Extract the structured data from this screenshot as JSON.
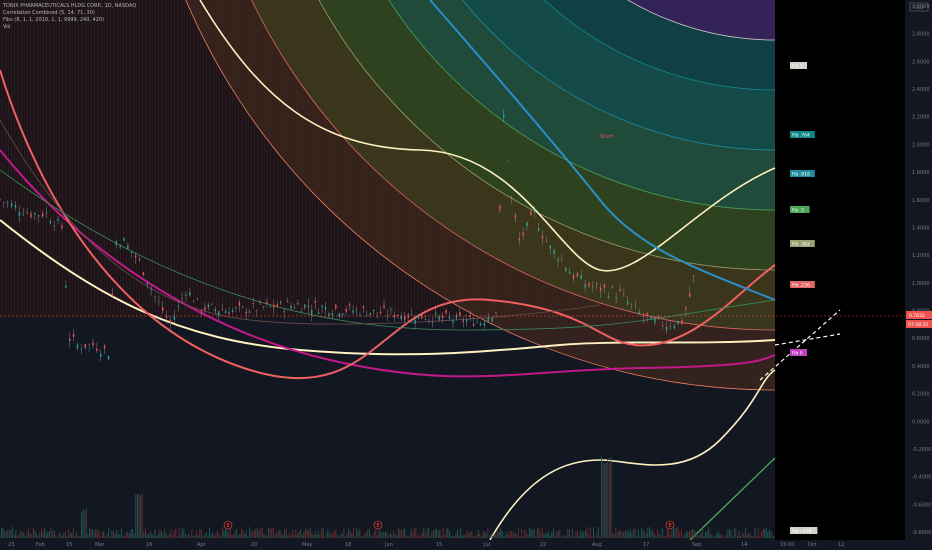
{
  "legend": {
    "symbol": "TONIX PHARMACEUTICALS HLDG CORP., 1D, NASDAQ",
    "indicator1": "Correlation Combined (5, 14, 71, 30)",
    "indicator2": "Fibs (8, 1, 1, 2010, 1, 1, 9999, 240, 420)",
    "indicator3": "Vol"
  },
  "chart_data": {
    "type": "line",
    "currency": "USD",
    "x_axis_ticks": [
      "23",
      "Feb",
      "15",
      "Mar",
      "16",
      "Apr",
      "20",
      "May",
      "18",
      "Jun",
      "15",
      "Jul",
      "22",
      "Aug",
      "17",
      "Sep",
      "14",
      "15:00",
      "Oct",
      "12"
    ],
    "y_axis_ticks": [
      "3.0000",
      "2.8000",
      "2.6000",
      "2.4000",
      "2.2000",
      "2.0000",
      "1.8000",
      "1.6000",
      "1.4000",
      "1.2000",
      "1.0000",
      "0.8000",
      "0.6000",
      "0.4000",
      "0.2000",
      "0.0000",
      "-0.2000",
      "-0.4000",
      "-0.6000",
      "-0.8000"
    ],
    "ylim": [
      -0.85,
      3.1
    ],
    "current_price": "0.7832",
    "countdown": "07:48:25",
    "price_series_approx": [
      {
        "x": 0.0,
        "y": 1.6
      },
      {
        "x": 0.02,
        "y": 1.55
      },
      {
        "x": 0.04,
        "y": 1.5
      },
      {
        "x": 0.06,
        "y": 1.5
      },
      {
        "x": 0.08,
        "y": 1.4
      },
      {
        "x": 0.09,
        "y": 0.6
      },
      {
        "x": 0.1,
        "y": 0.55
      },
      {
        "x": 0.12,
        "y": 0.55
      },
      {
        "x": 0.14,
        "y": 0.5
      },
      {
        "x": 0.15,
        "y": 1.3
      },
      {
        "x": 0.16,
        "y": 1.3
      },
      {
        "x": 0.18,
        "y": 1.15
      },
      {
        "x": 0.2,
        "y": 0.9
      },
      {
        "x": 0.22,
        "y": 0.7
      },
      {
        "x": 0.24,
        "y": 0.95
      },
      {
        "x": 0.26,
        "y": 0.82
      },
      {
        "x": 0.3,
        "y": 0.8
      },
      {
        "x": 0.34,
        "y": 0.82
      },
      {
        "x": 0.38,
        "y": 0.84
      },
      {
        "x": 0.42,
        "y": 0.82
      },
      {
        "x": 0.46,
        "y": 0.8
      },
      {
        "x": 0.5,
        "y": 0.78
      },
      {
        "x": 0.54,
        "y": 0.76
      },
      {
        "x": 0.58,
        "y": 0.74
      },
      {
        "x": 0.62,
        "y": 0.72
      },
      {
        "x": 0.64,
        "y": 0.8
      },
      {
        "x": 0.65,
        "y": 2.2
      },
      {
        "x": 0.66,
        "y": 1.6
      },
      {
        "x": 0.67,
        "y": 1.3
      },
      {
        "x": 0.68,
        "y": 1.4
      },
      {
        "x": 0.69,
        "y": 1.5
      },
      {
        "x": 0.7,
        "y": 1.35
      },
      {
        "x": 0.71,
        "y": 1.25
      },
      {
        "x": 0.72,
        "y": 1.2
      },
      {
        "x": 0.74,
        "y": 1.05
      },
      {
        "x": 0.76,
        "y": 0.98
      },
      {
        "x": 0.78,
        "y": 0.95
      },
      {
        "x": 0.8,
        "y": 0.92
      },
      {
        "x": 0.82,
        "y": 0.8
      },
      {
        "x": 0.84,
        "y": 0.72
      },
      {
        "x": 0.86,
        "y": 0.7
      },
      {
        "x": 0.88,
        "y": 0.72
      },
      {
        "x": 0.89,
        "y": 0.9
      },
      {
        "x": 0.9,
        "y": 1.15
      }
    ],
    "fib_labels": [
      {
        "label": "Fib 1",
        "color": "#cfd3c8"
      },
      {
        "label": "Fib .764",
        "color": "#0e8a8a"
      },
      {
        "label": "Fib .618",
        "color": "#1e8fa0"
      },
      {
        "label": "Fib .5",
        "color": "#4ca35a"
      },
      {
        "label": "Fib .382",
        "color": "#9aa070"
      },
      {
        "label": "Fib .236",
        "color": "#e06666"
      },
      {
        "label": "Fib 0",
        "color": "#c040c0"
      },
      {
        "label": "Fib -.618",
        "color": "#cfd3c8"
      }
    ],
    "annotation": "Short",
    "event_markers": [
      "E",
      "E",
      "E"
    ]
  }
}
